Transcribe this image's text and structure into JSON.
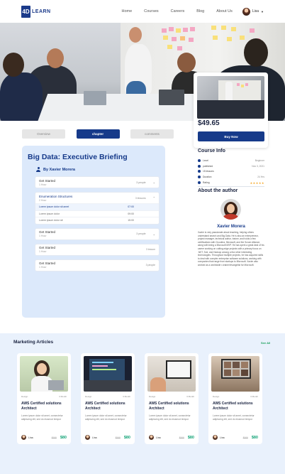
{
  "header": {
    "logo_mark": "4D",
    "logo_text": "LEARN",
    "nav": [
      "Home",
      "Courses",
      "Careers",
      "Blog",
      "About Us"
    ],
    "user_name": "Lisa"
  },
  "tabs": [
    "Overview",
    "chapter",
    "comments"
  ],
  "course": {
    "title": "Big Data: Executive Briefing",
    "author": "By Xavier Morera",
    "modules": [
      {
        "title": "Get Started",
        "duration": "1 Hour",
        "count": "3 people"
      },
      {
        "title": "Enumeration Structures",
        "duration": "2 Hour",
        "count": "3 lessons",
        "lessons": [
          {
            "title": "Lorem ipsum dolor sit amet",
            "time": "07:00"
          },
          {
            "title": "Lorem ipsum dolor",
            "time": "09:00"
          },
          {
            "title": "Lorem ipsum dolor sit",
            "time": "15:00"
          }
        ]
      },
      {
        "title": "Get Started",
        "duration": "1 Hour",
        "count": "3 people"
      },
      {
        "title": "Get Started",
        "duration": "1 Hour",
        "count": "3 lesson"
      },
      {
        "title": "Get Started",
        "duration": "1 Hour",
        "count": "3 people"
      }
    ]
  },
  "purchase": {
    "price": "$49.65",
    "buy_label": "Buy Now"
  },
  "course_info": {
    "title": "Course Info",
    "rows": [
      {
        "label": "Level",
        "value": "Beginner"
      },
      {
        "label": "published",
        "value": "Nov 3, 2021"
      },
      {
        "label": "15 lessons",
        "value": ""
      },
      {
        "label": "Duration",
        "value": "24 Hrs"
      },
      {
        "label": "Rating",
        "value": "★★★★★"
      }
    ]
  },
  "about_author": {
    "title": "About the author",
    "name": "Xavier Morera",
    "bio": "Xavier is very passionate about teaching, helping others understand search and Big Data. He is also an entrepreneur, project manager, technical author, trainer, and holds a few certifications with Cloudera, Microsoft, and the Scrum Alliance, along with being a Microsoft MVP. He has spent a great deal of his career working on cutting-edge projects with a primary focus on .NET, Solr, and Hadoop among a few other interesting technologies. Throughout multiple projects, he has acquired skills to deal with complex enterprise software solutions, working with companies that range from startups to Microsoft. Xavier also worked as a worldwide v-trainer/evangelist for Microsoft."
  },
  "articles": {
    "title": "Marketing Articles",
    "see_all": "See All",
    "items": [
      {
        "category": "Design",
        "duration": "3 Month",
        "title": "AWS Certified solutions Architect",
        "desc": "Lorem ipsum dolor sit amet, consectetur adipiscing elit, sed do eiusmod tempor",
        "author": "Lina",
        "old_price": "$100",
        "price": "$80"
      },
      {
        "category": "Design",
        "duration": "3 Month",
        "title": "AWS Certified solutions Architect",
        "desc": "Lorem ipsum dolor sit amet, consectetur adipiscing elit, sed do eiusmod tempor",
        "author": "Lina",
        "old_price": "$100",
        "price": "$80"
      },
      {
        "category": "Design",
        "duration": "3 Month",
        "title": "AWS Certified solutions Architect",
        "desc": "Lorem ipsum dolor sit amet, consectetur adipiscing elit, sed do eiusmod tempor",
        "author": "Lina",
        "old_price": "$100",
        "price": "$80"
      },
      {
        "category": "Design",
        "duration": "3 Month",
        "title": "AWS Certified solutions Architect",
        "desc": "Lorem ipsum dolor sit amet, consectetur adipiscing elit, sed do eiusmod tempor",
        "author": "Lina",
        "old_price": "$100",
        "price": "$80"
      }
    ]
  },
  "colors": {
    "primary": "#163a8a",
    "accent_green": "#18a57a",
    "panel": "#dce9fb",
    "star": "#f5a623"
  }
}
